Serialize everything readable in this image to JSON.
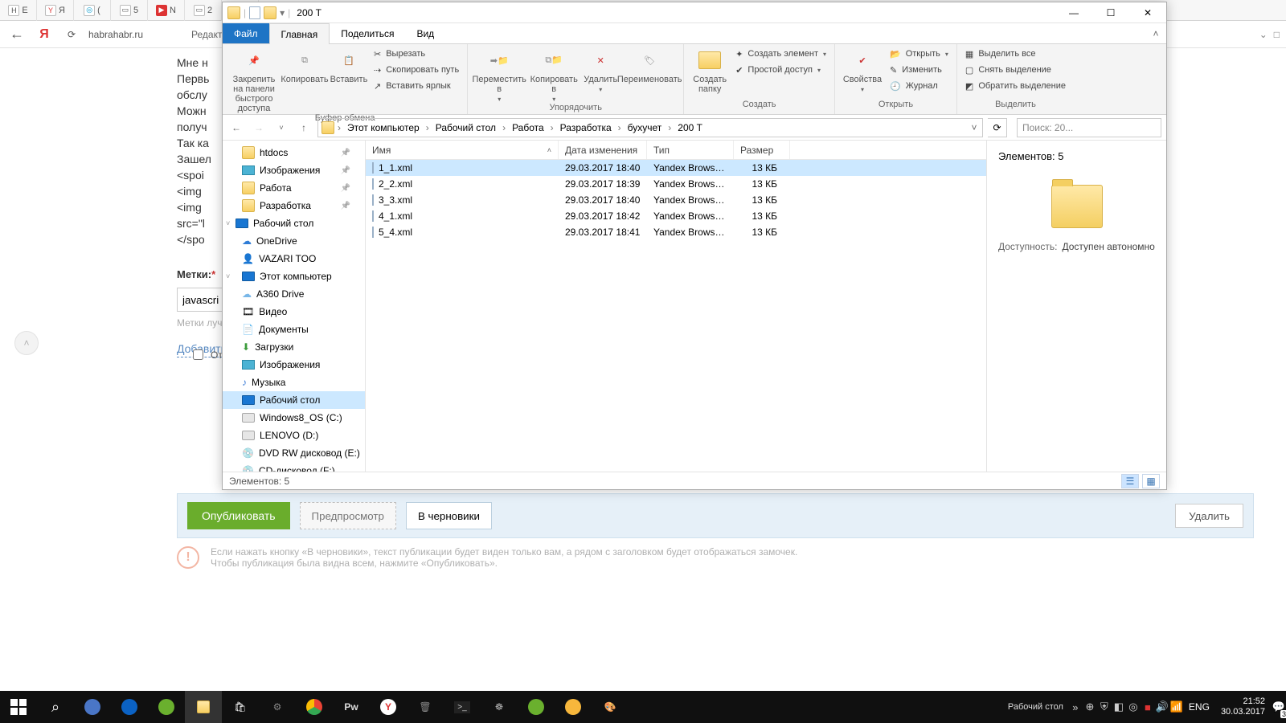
{
  "browser": {
    "tabs": [
      {
        "fav": "H",
        "label": "Е"
      },
      {
        "fav": "Y",
        "label": "Я"
      },
      {
        "fav": "◎",
        "label": "("
      },
      {
        "fav": "▭",
        "label": "5"
      },
      {
        "fav": "▶",
        "label": "N"
      },
      {
        "fav": "▭",
        "label": "2"
      },
      {
        "fav": "◎",
        "label": ""
      }
    ],
    "back": "←",
    "yandex": "Я",
    "reload": "⟳",
    "address": "habrahabr.ru",
    "page_crumb": "Редактиро",
    "expand": "⌄",
    "square": "□"
  },
  "page": {
    "lines": [
      "Мне н",
      "",
      "Первь",
      "обслу",
      "Можн",
      "получ",
      "",
      "Так ка",
      "",
      "Зашел",
      "",
      "<spoi",
      "<img",
      "<img",
      "src=\"l",
      "</spo"
    ],
    "oftop": "Отк",
    "metki_label": "Метки:",
    "metki_value": "javascri",
    "metki_hint": "Метки луч",
    "add_link": "Добавить",
    "publish": "Опубликовать",
    "preview": "Предпросмотр",
    "draft": "В черновики",
    "delete": "Удалить",
    "hint": "Если нажать кнопку «В черновики», текст публикации будет виден только вам, а рядом с заголовком будет отображаться замочек. Чтобы публикация была видна всем, нажмите «Опубликовать»."
  },
  "explorer": {
    "qat_sep": "|",
    "qat_dd": "▾",
    "title": "200 Т",
    "win": {
      "min": "—",
      "max": "☐",
      "close": "✕"
    },
    "tabs": {
      "file": "Файл",
      "home": "Главная",
      "share": "Поделиться",
      "view": "Вид",
      "expand": "˄"
    },
    "ribbon": {
      "pin": "Закрепить на панели быстрого доступа",
      "copy": "Копировать",
      "paste": "Вставить",
      "cut": "Вырезать",
      "copypath": "Скопировать путь",
      "shortcut": "Вставить ярлык",
      "g_clip": "Буфер обмена",
      "moveto": "Переместить в",
      "copyto": "Копировать в",
      "delete": "Удалить",
      "rename": "Переименовать",
      "g_org": "Упорядочить",
      "newfolder": "Создать папку",
      "newitem": "Создать элемент",
      "easyaccess": "Простой доступ",
      "g_new": "Создать",
      "props": "Свойства",
      "open": "Открыть",
      "edit": "Изменить",
      "history": "Журнал",
      "g_open": "Открыть",
      "selectall": "Выделить все",
      "selectnone": "Снять выделение",
      "invert": "Обратить выделение",
      "g_select": "Выделить"
    },
    "nav": {
      "back": "←",
      "fwd": "→",
      "dd": "˅",
      "up": "↑"
    },
    "breadcrumb": [
      "Этот компьютер",
      "Рабочий стол",
      "Работа",
      "Разработка",
      "бухучет",
      "200 Т"
    ],
    "bc_drop": "˅",
    "refresh": "⟳",
    "search_placeholder": "Поиск: 20...",
    "navpane": [
      {
        "label": "htdocs",
        "pinned": true,
        "icon": "folder"
      },
      {
        "label": "Изображения",
        "pinned": true,
        "icon": "pictures"
      },
      {
        "label": "Работа",
        "pinned": true,
        "icon": "folder"
      },
      {
        "label": "Разработка",
        "pinned": true,
        "icon": "folder"
      },
      {
        "label": "Рабочий стол",
        "icon": "desktop",
        "lvl": 1,
        "chev": "˅"
      },
      {
        "label": "OneDrive",
        "icon": "onedrive"
      },
      {
        "label": "VAZARI TOO",
        "icon": "user"
      },
      {
        "label": "Этот компьютер",
        "icon": "pc",
        "chev": "˅"
      },
      {
        "label": "A360 Drive",
        "icon": "cloud"
      },
      {
        "label": "Видео",
        "icon": "video"
      },
      {
        "label": "Документы",
        "icon": "docs"
      },
      {
        "label": "Загрузки",
        "icon": "download"
      },
      {
        "label": "Изображения",
        "icon": "pictures"
      },
      {
        "label": "Музыка",
        "icon": "music"
      },
      {
        "label": "Рабочий стол",
        "icon": "desktop",
        "sel": true
      },
      {
        "label": "Windows8_OS (C:)",
        "icon": "drive"
      },
      {
        "label": "LENOVO (D:)",
        "icon": "drive"
      },
      {
        "label": "DVD RW дисковод (E:)",
        "icon": "disc"
      },
      {
        "label": "CD-дисковод (F:)",
        "icon": "disc"
      }
    ],
    "columns": {
      "name": "Имя",
      "date": "Дата изменения",
      "type": "Тип",
      "size": "Размер"
    },
    "rows": [
      {
        "name": "1_1.xml",
        "date": "29.03.2017 18:40",
        "type": "Yandex Browser X...",
        "size": "13 КБ",
        "sel": true
      },
      {
        "name": "2_2.xml",
        "date": "29.03.2017 18:39",
        "type": "Yandex Browser X...",
        "size": "13 КБ"
      },
      {
        "name": "3_3.xml",
        "date": "29.03.2017 18:40",
        "type": "Yandex Browser X...",
        "size": "13 КБ"
      },
      {
        "name": "4_1.xml",
        "date": "29.03.2017 18:42",
        "type": "Yandex Browser X...",
        "size": "13 КБ"
      },
      {
        "name": "5_4.xml",
        "date": "29.03.2017 18:41",
        "type": "Yandex Browser X...",
        "size": "13 КБ"
      }
    ],
    "details": {
      "elements_label": "Элементов:",
      "elements_count": "5",
      "avail_key": "Доступность:",
      "avail_val": "Доступен автономно"
    },
    "status": "Элементов: 5"
  },
  "taskbar": {
    "label": "Рабочий стол",
    "overflow": "»",
    "lang": "ENG",
    "time": "21:52",
    "date": "30.03.2017",
    "notif": "3"
  }
}
